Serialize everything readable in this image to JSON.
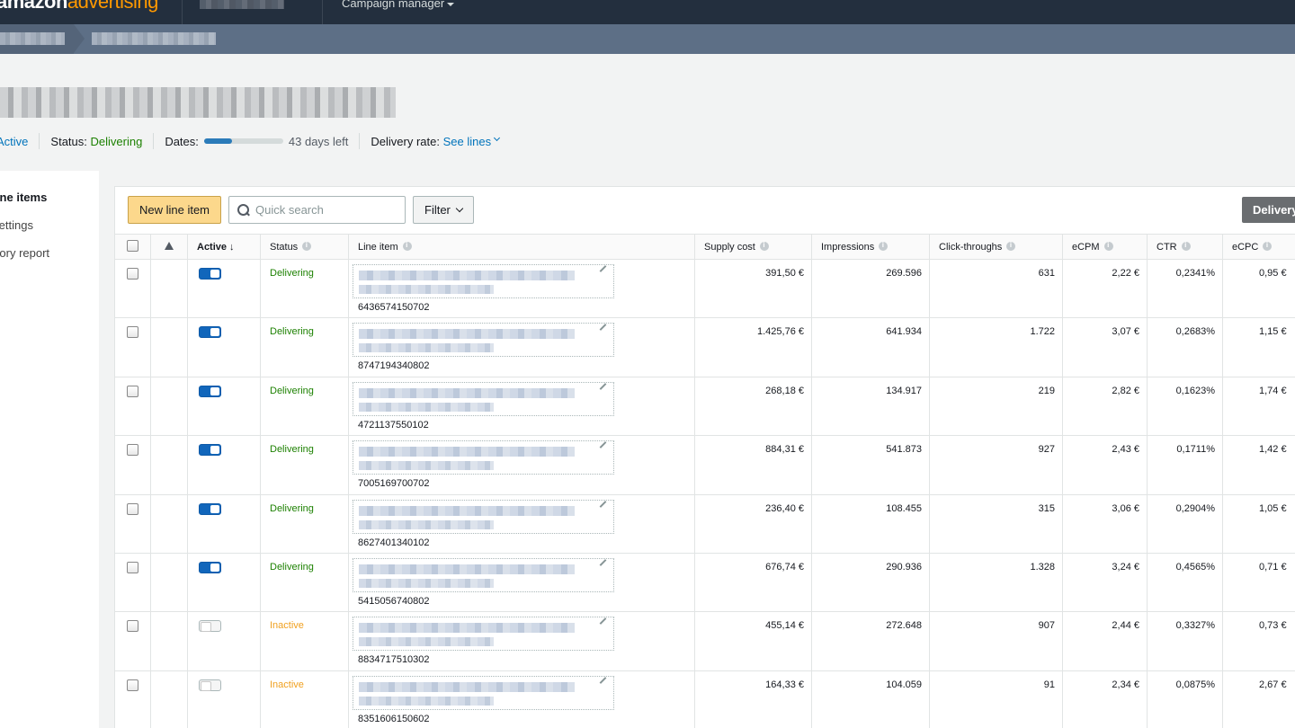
{
  "topnav": {
    "logo_part1": "amazon",
    "logo_part2": "advertising",
    "campaign_menu": "Campaign manager"
  },
  "header": {
    "state_label": "Active",
    "status_label": "Status:",
    "status_value": "Delivering",
    "dates_label": "Dates:",
    "dates_progress": 0.35,
    "days_left": "43 days left",
    "delivery_rate_label": "Delivery rate:",
    "delivery_rate_link": "See lines"
  },
  "leftnav": {
    "items": [
      "Line items",
      "Settings",
      "Inventory report"
    ]
  },
  "toolbar": {
    "new_line_item": "New line item",
    "search_placeholder": "Quick search",
    "filter": "Filter",
    "delivery": "Delivery"
  },
  "table": {
    "columns": {
      "active": "Active",
      "status": "Status",
      "line_item": "Line item",
      "supply_cost": "Supply cost",
      "impressions": "Impressions",
      "click_throughs": "Click-throughs",
      "ecpm": "eCPM",
      "ctr": "CTR",
      "ecpc": "eCPC"
    },
    "rows": [
      {
        "active": true,
        "status": "Delivering",
        "id": "6436574150702",
        "supply_cost": "391,50 €",
        "impressions": "269.596",
        "clicks": "631",
        "ecpm": "2,22 €",
        "ctr": "0,2341%",
        "ecpc": "0,95 €"
      },
      {
        "active": true,
        "status": "Delivering",
        "id": "8747194340802",
        "supply_cost": "1.425,76 €",
        "impressions": "641.934",
        "clicks": "1.722",
        "ecpm": "3,07 €",
        "ctr": "0,2683%",
        "ecpc": "1,15 €"
      },
      {
        "active": true,
        "status": "Delivering",
        "id": "4721137550102",
        "supply_cost": "268,18 €",
        "impressions": "134.917",
        "clicks": "219",
        "ecpm": "2,82 €",
        "ctr": "0,1623%",
        "ecpc": "1,74 €"
      },
      {
        "active": true,
        "status": "Delivering",
        "id": "7005169700702",
        "supply_cost": "884,31 €",
        "impressions": "541.873",
        "clicks": "927",
        "ecpm": "2,43 €",
        "ctr": "0,1711%",
        "ecpc": "1,42 €"
      },
      {
        "active": true,
        "status": "Delivering",
        "id": "8627401340102",
        "supply_cost": "236,40 €",
        "impressions": "108.455",
        "clicks": "315",
        "ecpm": "3,06 €",
        "ctr": "0,2904%",
        "ecpc": "1,05 €"
      },
      {
        "active": true,
        "status": "Delivering",
        "id": "5415056740802",
        "supply_cost": "676,74 €",
        "impressions": "290.936",
        "clicks": "1.328",
        "ecpm": "3,24 €",
        "ctr": "0,4565%",
        "ecpc": "0,71 €"
      },
      {
        "active": false,
        "status": "Inactive",
        "id": "8834717510302",
        "supply_cost": "455,14 €",
        "impressions": "272.648",
        "clicks": "907",
        "ecpm": "2,44 €",
        "ctr": "0,3327%",
        "ecpc": "0,73 €"
      },
      {
        "active": false,
        "status": "Inactive",
        "id": "8351606150602",
        "supply_cost": "164,33 €",
        "impressions": "104.059",
        "clicks": "91",
        "ecpm": "2,34 €",
        "ctr": "0,0875%",
        "ecpc": "2,67 €"
      }
    ]
  }
}
